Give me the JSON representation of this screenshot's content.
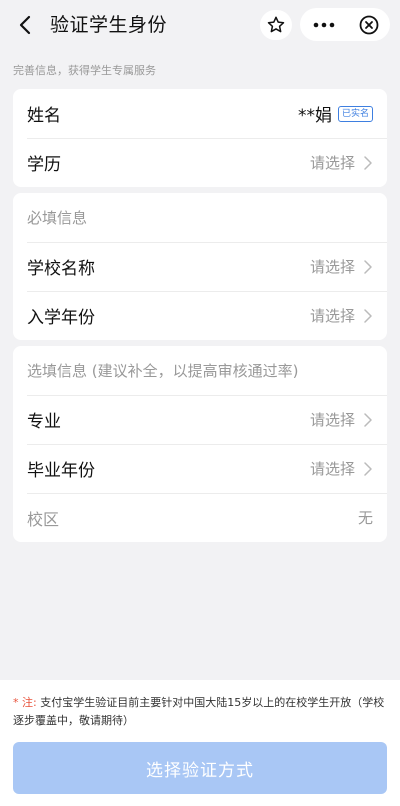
{
  "nav": {
    "title": "验证学生身份",
    "back_icon": "chevron-left-icon",
    "star_icon": "star-icon",
    "more_icon": "more-dots-icon",
    "close_icon": "close-circle-icon"
  },
  "hint": "完善信息，获得学生专属服务",
  "basic_card": {
    "name_label": "姓名",
    "name_value": "**娟",
    "name_badge": "已实名",
    "education_label": "学历",
    "education_placeholder": "请选择"
  },
  "required_card": {
    "section_title": "必填信息",
    "school_label": "学校名称",
    "school_placeholder": "请选择",
    "enroll_label": "入学年份",
    "enroll_placeholder": "请选择"
  },
  "optional_card": {
    "section_title": "选填信息 (建议补全，以提高审核通过率)",
    "major_label": "专业",
    "major_placeholder": "请选择",
    "grad_label": "毕业年份",
    "grad_placeholder": "请选择",
    "campus_label": "校区",
    "campus_value": "无"
  },
  "footer": {
    "notice_star": "* 注:",
    "notice_text": " 支付宝学生验证目前主要针对中国大陆15岁以上的在校学生开放（学校逐步覆盖中，敬请期待）",
    "submit_label": "选择验证方式"
  },
  "colors": {
    "accent": "#3e7fe0",
    "button_disabled": "#a9c7f5",
    "notice_red": "#e8533c",
    "background": "#f2f2f4"
  }
}
